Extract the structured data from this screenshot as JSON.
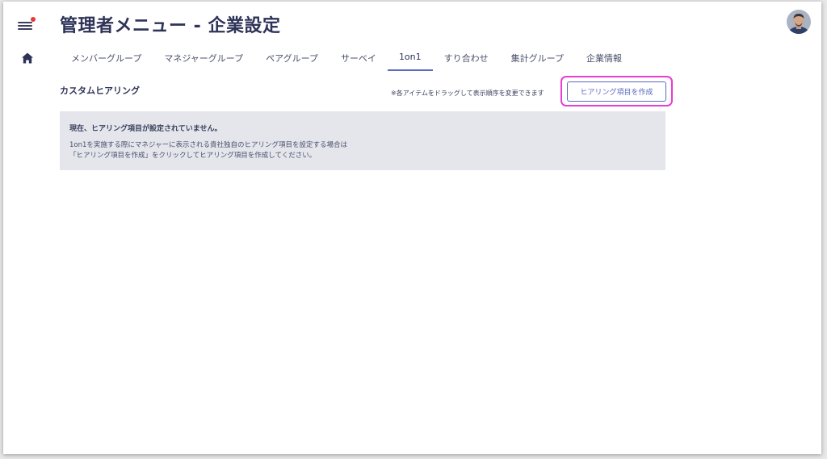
{
  "colors": {
    "accent": "#5c6bc0",
    "highlight": "#e83cd3",
    "notification_dot": "#e53935",
    "title": "#2e3357",
    "panel_bg": "#e4e6ec"
  },
  "nav": {
    "menu_icon": "hamburger-menu-icon",
    "home_icon": "home-icon"
  },
  "header": {
    "title": "管理者メニュー - 企業設定"
  },
  "tabs": [
    {
      "label": "メンバーグループ",
      "active": false
    },
    {
      "label": "マネジャーグループ",
      "active": false
    },
    {
      "label": "ペアグループ",
      "active": false
    },
    {
      "label": "サーベイ",
      "active": false
    },
    {
      "label": "1on1",
      "active": true
    },
    {
      "label": "すり合わせ",
      "active": false
    },
    {
      "label": "集計グループ",
      "active": false
    },
    {
      "label": "企業情報",
      "active": false
    }
  ],
  "section": {
    "title": "カスタムヒアリング",
    "hint": "※各アイテムをドラッグして表示順序を変更できます",
    "create_button": "ヒアリング項目を作成"
  },
  "empty_state": {
    "title": "現在、ヒアリング項目が設定されていません。",
    "line1": "1on1を実施する際にマネジャーに表示される貴社独自のヒアリング項目を設定する場合は",
    "line2": "「ヒアリング項目を作成」をクリックしてヒアリング項目を作成してください。"
  }
}
